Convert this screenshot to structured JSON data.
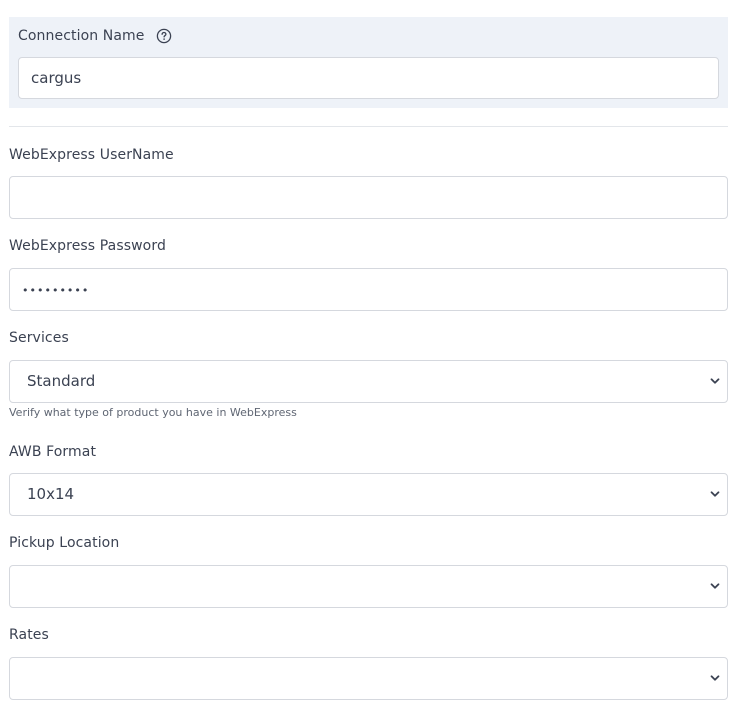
{
  "connection": {
    "label": "Connection Name",
    "help_icon": "question-circle-icon",
    "value": "cargus"
  },
  "fields": {
    "username": {
      "label": "WebExpress UserName",
      "value": ""
    },
    "password": {
      "label": "WebExpress Password",
      "value": "•••••••••"
    },
    "services": {
      "label": "Services",
      "selected": "Standard",
      "hint": "Verify what type of product you have in WebExpress"
    },
    "awb_format": {
      "label": "AWB Format",
      "selected": "10x14"
    },
    "pickup_location": {
      "label": "Pickup Location",
      "selected": ""
    },
    "rates": {
      "label": "Rates",
      "selected": ""
    }
  },
  "icons": {
    "select_chevron": "chevron-down-icon"
  },
  "colors": {
    "panel_background": "#eef2f8",
    "border": "#d5d8de",
    "text": "#3b4252"
  }
}
